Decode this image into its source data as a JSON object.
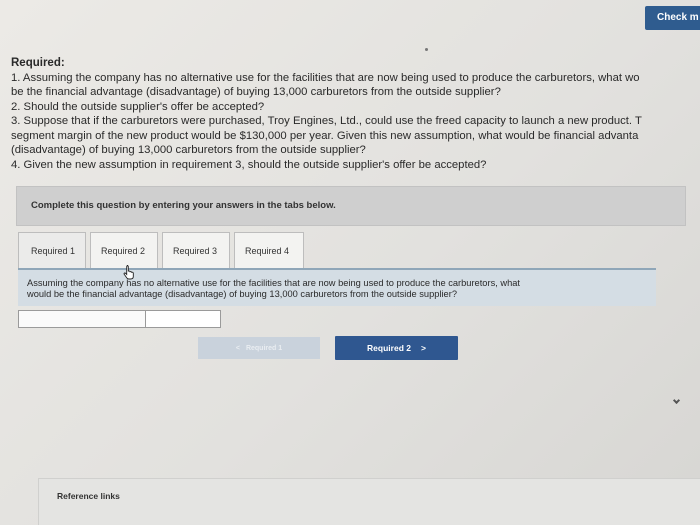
{
  "header": {
    "check_label": "Check m"
  },
  "requirements": {
    "heading": "Required:",
    "lines": [
      "1. Assuming the company has no alternative use for the facilities that are now being used to produce the carburetors, what wo",
      "be the financial advantage (disadvantage) of buying 13,000 carburetors from the outside supplier?",
      "2. Should the outside supplier's offer be accepted?",
      "3. Suppose that if the carburetors were purchased, Troy Engines, Ltd., could use the freed capacity to launch a new product. T",
      "segment margin of the new product would be $130,000 per year. Given this new assumption, what would be financial advanta",
      "(disadvantage) of buying 13,000 carburetors from the outside supplier?",
      "4. Given the new assumption in requirement 3, should the outside supplier's offer be accepted?"
    ]
  },
  "instruction": "Complete this question by entering your answers in the tabs below.",
  "tabs": [
    {
      "label": "Required 1"
    },
    {
      "label": "Required 2"
    },
    {
      "label": "Required 3"
    },
    {
      "label": "Required 4"
    }
  ],
  "question": {
    "line1": "Assuming the company has no alternative use for the facilities that are now being used to produce the carburetors, what",
    "line2": "would be the financial advantage (disadvantage) of buying 13,000 carburetors from the outside supplier?"
  },
  "answer": {
    "label": "",
    "value": ""
  },
  "navigation": {
    "prev_label": "Required 1",
    "prev_glyph": "<",
    "next_label": "Required 2",
    "next_glyph": ">"
  },
  "footer": {
    "reference_links": "Reference links"
  },
  "colors": {
    "primary_button": "#2f5790",
    "disabled_button": "#c9d2dc",
    "question_background": "#d4dde4",
    "instruction_background": "#cfcfcf"
  },
  "icons": {
    "cursor": "hand-pointer-icon",
    "scroll": "chevron-down-icon"
  }
}
